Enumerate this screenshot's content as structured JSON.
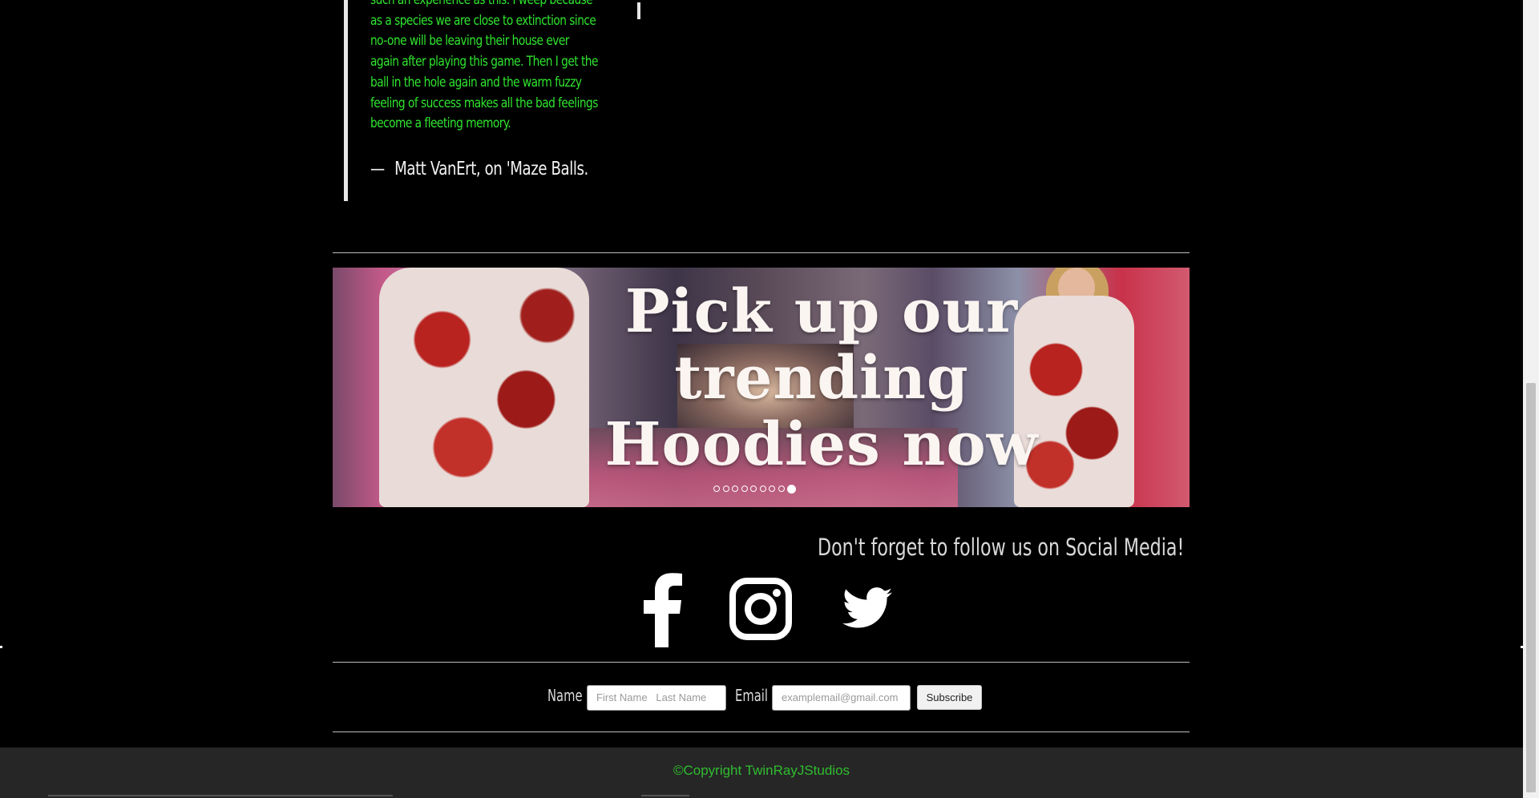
{
  "testimonial": {
    "quote": "such an experience as this. I weep because as a species we are close to extinction since no-one will be leaving their house ever again after playing this game. Then I get the ball in the hole again and the warm fuzzy feeling of success makes all the bad feelings become a fleeting memory.",
    "dash": "—",
    "attribution": "Matt VanErt, on 'Maze Balls."
  },
  "banner": {
    "title_line1": "Pick up our",
    "title_line2": "trending",
    "title_line3": "Hoodies now",
    "slides_total": 9,
    "active_slide": 9
  },
  "social": {
    "heading": "Don't forget to follow us on Social Media!",
    "icons": [
      "facebook-icon",
      "instagram-icon",
      "twitter-icon"
    ]
  },
  "subscribe_form": {
    "name_label": "Name",
    "first_name_placeholder": "First Name",
    "last_name_placeholder": "Last Name",
    "email_label": "Email",
    "email_placeholder": "examplemail@gmail.com",
    "button_label": "Subscribe"
  },
  "footer": {
    "copyright": "©Copyright TwinRayJStudios"
  },
  "colors": {
    "quote_text": "#2fe42f",
    "copyright_text": "#2fbd2f",
    "footer_bg": "#262626",
    "page_bg": "#000000"
  }
}
